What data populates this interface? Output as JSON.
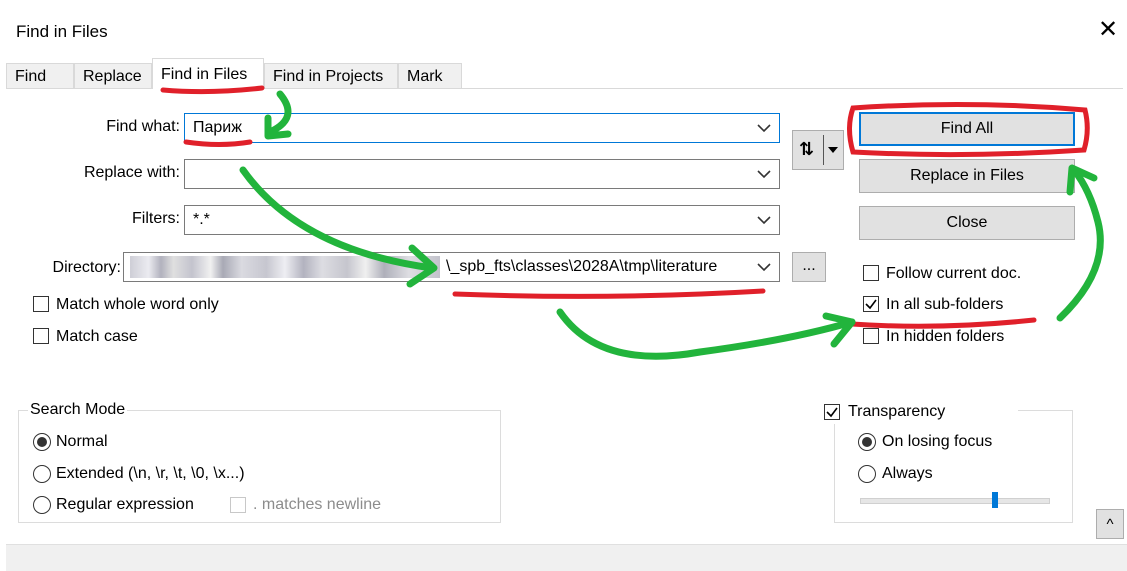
{
  "window": {
    "title": "Find in Files"
  },
  "tabs": [
    {
      "label": "Find"
    },
    {
      "label": "Replace"
    },
    {
      "label": "Find in Files"
    },
    {
      "label": "Find in Projects"
    },
    {
      "label": "Mark"
    }
  ],
  "fields": {
    "find_what": {
      "label": "Find what:",
      "value": "Париж"
    },
    "replace_with": {
      "label": "Replace with:",
      "value": ""
    },
    "filters": {
      "label": "Filters:",
      "value": "*.*"
    },
    "directory": {
      "label": "Directory:",
      "value": "\\_spb_fts\\classes\\2028A\\tmp\\literature"
    }
  },
  "buttons": {
    "find_all": "Find All",
    "replace_in_files": "Replace in Files",
    "close": "Close",
    "browse": "..."
  },
  "options": {
    "match_whole_word": {
      "label": "Match whole word only",
      "checked": false
    },
    "match_case": {
      "label": "Match case",
      "checked": false
    },
    "follow_current_doc": {
      "label": "Follow current doc.",
      "checked": false
    },
    "in_all_subfolders": {
      "label": "In all sub-folders",
      "checked": true
    },
    "in_hidden_folders": {
      "label": "In hidden folders",
      "checked": false
    }
  },
  "search_mode": {
    "title": "Search Mode",
    "normal": "Normal",
    "extended": "Extended (\\n, \\r, \\t, \\0, \\x...)",
    "regex": "Regular expression",
    "matches_newline": ". matches newline",
    "selected": "normal"
  },
  "transparency": {
    "label": "Transparency",
    "checked": true,
    "on_losing_focus": "On losing focus",
    "always": "Always",
    "selected": "on_losing_focus",
    "slider_level": 0.72
  },
  "collapse_button": "^",
  "colors": {
    "annotation_red": "#e0202a",
    "annotation_green": "#22b43c",
    "accent": "#0078d7"
  }
}
